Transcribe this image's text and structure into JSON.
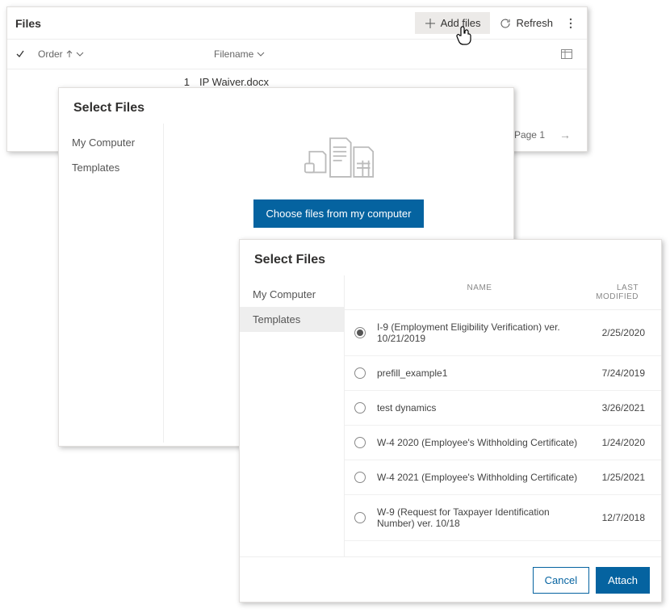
{
  "files_panel": {
    "title": "Files",
    "add_label": "Add files",
    "refresh_label": "Refresh",
    "col_order": "Order",
    "col_filename": "Filename",
    "row": {
      "order": "1",
      "filename": "IP Waiver.docx"
    },
    "page_label": "Page 1"
  },
  "dialog1": {
    "title": "Select Files",
    "side_my_computer": "My Computer",
    "side_templates": "Templates",
    "choose_btn": "Choose files from my computer"
  },
  "dialog2": {
    "title": "Select Files",
    "side_my_computer": "My Computer",
    "side_templates": "Templates",
    "th_name": "NAME",
    "th_modified": "LAST MODIFIED",
    "rows": [
      {
        "name": "I-9 (Employment Eligibility Verification) ver. 10/21/2019",
        "date": "2/25/2020",
        "selected": true
      },
      {
        "name": "prefill_example1",
        "date": "7/24/2019",
        "selected": false
      },
      {
        "name": "test dynamics",
        "date": "3/26/2021",
        "selected": false
      },
      {
        "name": "W-4 2020 (Employee's Withholding Certificate)",
        "date": "1/24/2020",
        "selected": false
      },
      {
        "name": "W-4 2021 (Employee's Withholding Certificate)",
        "date": "1/25/2021",
        "selected": false
      },
      {
        "name": "W-9 (Request for Taxpayer Identification Number) ver. 10/18",
        "date": "12/7/2018",
        "selected": false
      }
    ],
    "cancel": "Cancel",
    "attach": "Attach"
  }
}
